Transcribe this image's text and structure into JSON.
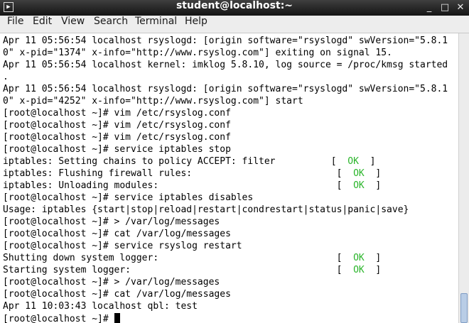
{
  "window": {
    "title": "student@localhost:~",
    "app_icon": "terminal-icon",
    "app_icon_glyph": "▶",
    "buttons": {
      "minimize": "_",
      "maximize": "□",
      "close": "✕"
    }
  },
  "menu": {
    "file": "File",
    "edit": "Edit",
    "view": "View",
    "search": "Search",
    "terminal": "Terminal",
    "help": "Help"
  },
  "terminal": {
    "lines": [
      "Apr 11 05:56:54 localhost rsyslogd: [origin software=\"rsyslogd\" swVersion=\"5.8.1",
      "0\" x-pid=\"1374\" x-info=\"http://www.rsyslog.com\"] exiting on signal 15.",
      "Apr 11 05:56:54 localhost kernel: imklog 5.8.10, log source = /proc/kmsg started",
      ".",
      "Apr 11 05:56:54 localhost rsyslogd: [origin software=\"rsyslogd\" swVersion=\"5.8.1",
      "0\" x-pid=\"4252\" x-info=\"http://www.rsyslog.com\"] start",
      "[root@localhost ~]# vim /etc/rsyslog.conf",
      "[root@localhost ~]# vim /etc/rsyslog.conf",
      "[root@localhost ~]# vim /etc/rsyslog.conf",
      "[root@localhost ~]# service iptables stop",
      {
        "text": "iptables: Setting chains to policy ACCEPT: filter          ",
        "open": "[  ",
        "ok": "OK",
        "close": "  ]"
      },
      {
        "text": "iptables: Flushing firewall rules:                          ",
        "open": "[  ",
        "ok": "OK",
        "close": "  ]"
      },
      {
        "text": "iptables: Unloading modules:                                ",
        "open": "[  ",
        "ok": "OK",
        "close": "  ]"
      },
      "[root@localhost ~]# service iptables disables",
      "Usage: iptables {start|stop|reload|restart|condrestart|status|panic|save}",
      "[root@localhost ~]# > /var/log/messages",
      "[root@localhost ~]# cat /var/log/messages",
      "[root@localhost ~]# service rsyslog restart",
      {
        "text": "Shutting down system logger:                                ",
        "open": "[  ",
        "ok": "OK",
        "close": "  ]"
      },
      {
        "text": "Starting system logger:                                     ",
        "open": "[  ",
        "ok": "OK",
        "close": "  ]"
      },
      "[root@localhost ~]# > /var/log/messages",
      "[root@localhost ~]# cat /var/log/messages",
      "Apr 11 10:03:43 localhost qbl: test",
      {
        "prompt": "[root@localhost ~]# ",
        "cursor": true
      }
    ]
  },
  "colors": {
    "ok": "#2ab52a",
    "titlebar": "#1e1e1e",
    "menubar": "#ededed",
    "terminal_bg": "#ffffff",
    "terminal_fg": "#000000"
  }
}
